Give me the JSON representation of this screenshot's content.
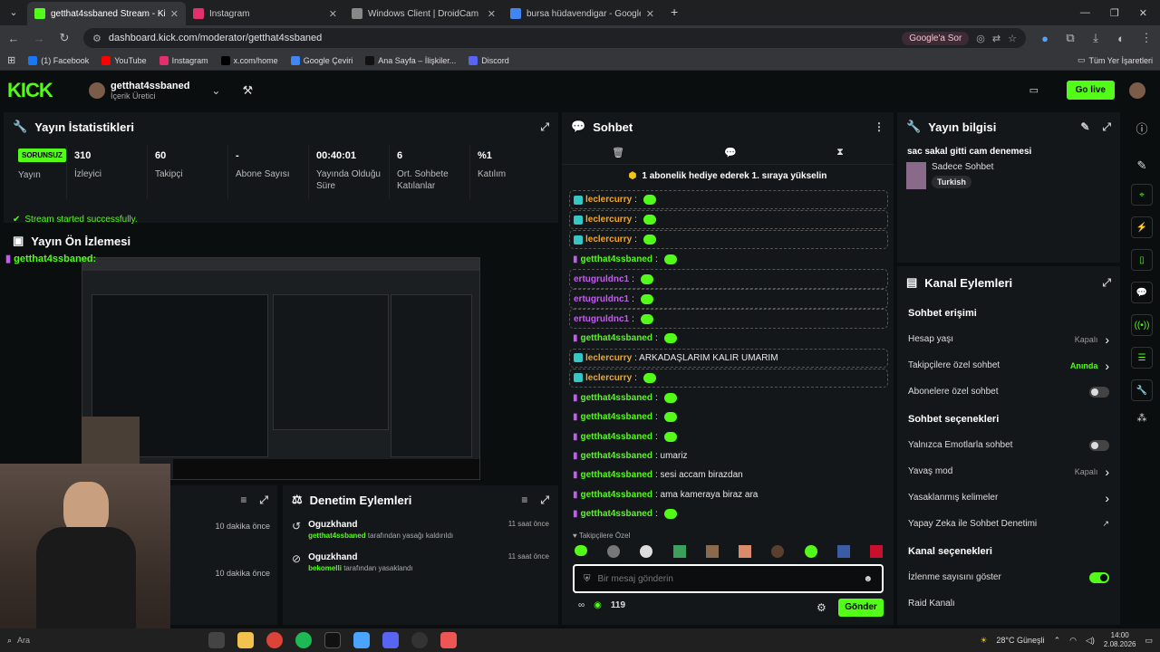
{
  "browser": {
    "tabs": [
      {
        "title": "getthat4ssbaned Stream - Kick",
        "color": "#53fc18"
      },
      {
        "title": "Instagram",
        "color": "#e1306c"
      },
      {
        "title": "Windows Client | DroidCam",
        "color": "#888888"
      },
      {
        "title": "bursa hüdavendigar - Google'da Ara",
        "color": "#4285f4"
      }
    ],
    "url": "dashboard.kick.com/moderator/getthat4ssbaned",
    "google_btn": "Google'a Sor",
    "bookmarks": [
      "(1) Facebook",
      "YouTube",
      "Instagram",
      "x.com/home",
      "Google Çeviri",
      "Ana Sayfa – İlişkiler...",
      "Discord"
    ],
    "bookmark_colors": [
      "#1877f2",
      "#ff0000",
      "#e1306c",
      "#000000",
      "#4285f4",
      "#111111",
      "#5865f2"
    ],
    "all_bookmarks": "Tüm Yer İşaretleri"
  },
  "header": {
    "logo": "KICK",
    "channel_name": "getthat4ssbaned",
    "channel_role": "İçerik Üretici",
    "go_live": "Go live"
  },
  "stats_panel": {
    "title": "Yayın İstatistikleri",
    "status_badge": "SORUNSUZ",
    "status_label": "Yayın",
    "items": [
      {
        "value": "310",
        "label": "İzleyici"
      },
      {
        "value": "60",
        "label": "Takipçi"
      },
      {
        "value": "-",
        "label": "Abone Sayısı"
      },
      {
        "value": "00:40:01",
        "label": "Yayında Olduğu Süre"
      },
      {
        "value": "6",
        "label": "Ort. Sohbete Katılanlar"
      },
      {
        "value": "%1",
        "label": "Katılım"
      }
    ],
    "notice": "Stream started successfully."
  },
  "preview": {
    "title": "Yayın Ön İzlemesi",
    "overlay_user": "getthat4ssbaned"
  },
  "mod_actions": {
    "title": "Denetim Eylemleri",
    "left_times": [
      "10 dakika önce",
      "10 dakika önce"
    ],
    "items": [
      {
        "user": "Oguzkhand",
        "target": "getthat4ssbaned",
        "text": " tarafından yasağı kaldırıldı",
        "time": "11 saat önce"
      },
      {
        "user": "Oguzkhand",
        "target": "bekomelli",
        "text": " tarafından yasaklandı",
        "time": "11 saat önce"
      }
    ]
  },
  "chat": {
    "title": "Sohbet",
    "pinned": "1 abonelik hediye ederek 1. sıraya yükselin",
    "messages": [
      {
        "user": "leclercurry",
        "text": ":",
        "color": "#f5a623",
        "badge": true,
        "emote": true,
        "boxed": true
      },
      {
        "user": "leclercurry",
        "text": ":",
        "color": "#f5a623",
        "badge": true,
        "emote": true,
        "boxed": true
      },
      {
        "user": "leclercurry",
        "text": ":",
        "color": "#f5a623",
        "badge": true,
        "emote": true,
        "boxed": true
      },
      {
        "user": "getthat4ssbaned",
        "text": ":",
        "color": "#53fc18",
        "badge": false,
        "emote": true,
        "boxed": false
      },
      {
        "user": "ertugruldnc1",
        "text": ":",
        "color": "#c45bf2",
        "badge": false,
        "emote": true,
        "boxed": true
      },
      {
        "user": "ertugruldnc1",
        "text": ":",
        "color": "#c45bf2",
        "badge": false,
        "emote": true,
        "boxed": true
      },
      {
        "user": "ertugruldnc1",
        "text": ":",
        "color": "#c45bf2",
        "badge": false,
        "emote": true,
        "boxed": true
      },
      {
        "user": "getthat4ssbaned",
        "text": ":",
        "color": "#53fc18",
        "badge": false,
        "emote": true,
        "boxed": false
      },
      {
        "user": "leclercurry",
        "text": ": ARKADAŞLARIM KALIR UMARIM",
        "color": "#f5a623",
        "badge": true,
        "emote": false,
        "boxed": true
      },
      {
        "user": "leclercurry",
        "text": ":",
        "color": "#f5a623",
        "badge": true,
        "emote": true,
        "boxed": true
      },
      {
        "user": "getthat4ssbaned",
        "text": ":",
        "color": "#53fc18",
        "badge": false,
        "emote": true,
        "boxed": false
      },
      {
        "user": "getthat4ssbaned",
        "text": ":",
        "color": "#53fc18",
        "badge": false,
        "emote": true,
        "boxed": false
      },
      {
        "user": "getthat4ssbaned",
        "text": ":",
        "color": "#53fc18",
        "badge": false,
        "emote": true,
        "boxed": false
      },
      {
        "user": "getthat4ssbaned",
        "text": ": umariz",
        "color": "#53fc18",
        "badge": false,
        "emote": false,
        "boxed": false
      },
      {
        "user": "getthat4ssbaned",
        "text": ": sesi accam birazdan",
        "color": "#53fc18",
        "badge": false,
        "emote": false,
        "boxed": false
      },
      {
        "user": "getthat4ssbaned",
        "text": ": ama kameraya biraz ara",
        "color": "#53fc18",
        "badge": false,
        "emote": false,
        "boxed": false
      },
      {
        "user": "getthat4ssbaned",
        "text": ":",
        "color": "#53fc18",
        "badge": false,
        "emote": true,
        "boxed": false
      }
    ],
    "followers_only_label": "Takipçilere Özel",
    "input_placeholder": "Bir mesaj gönderin",
    "points": "119",
    "send": "Gönder"
  },
  "stream_info": {
    "title": "Yayın bilgisi",
    "stream_title": "sac sakal gitti cam denemesi",
    "category": "Sadece Sohbet",
    "language": "Turkish"
  },
  "channel_actions": {
    "title": "Kanal Eylemleri",
    "sections": [
      {
        "heading": "Sohbet erişimi",
        "rows": [
          {
            "label": "Hesap yaşı",
            "value": "Kapalı",
            "kind": "chevron"
          },
          {
            "label": "Takipçilere özel sohbet",
            "value": "Anında",
            "kind": "chevron-green"
          },
          {
            "label": "Abonelere özel sohbet",
            "value": "",
            "kind": "toggle-off"
          }
        ]
      },
      {
        "heading": "Sohbet seçenekleri",
        "rows": [
          {
            "label": "Yalnızca Emotlarla sohbet",
            "value": "",
            "kind": "toggle-off"
          },
          {
            "label": "Yavaş mod",
            "value": "Kapalı",
            "kind": "chevron"
          },
          {
            "label": "Yasaklanmış kelimeler",
            "value": "",
            "kind": "chevron"
          },
          {
            "label": "Yapay Zeka ile Sohbet Denetimi",
            "value": "",
            "kind": "external"
          }
        ]
      },
      {
        "heading": "Kanal seçenekleri",
        "rows": [
          {
            "label": "İzlenme sayısını göster",
            "value": "",
            "kind": "toggle-on"
          },
          {
            "label": "Raid Kanalı",
            "value": "",
            "kind": "none"
          }
        ]
      }
    ]
  },
  "taskbar": {
    "weather": "28°C Güneşli",
    "time": "14:00",
    "date": "2.08.2026",
    "search_text": "Ara"
  }
}
